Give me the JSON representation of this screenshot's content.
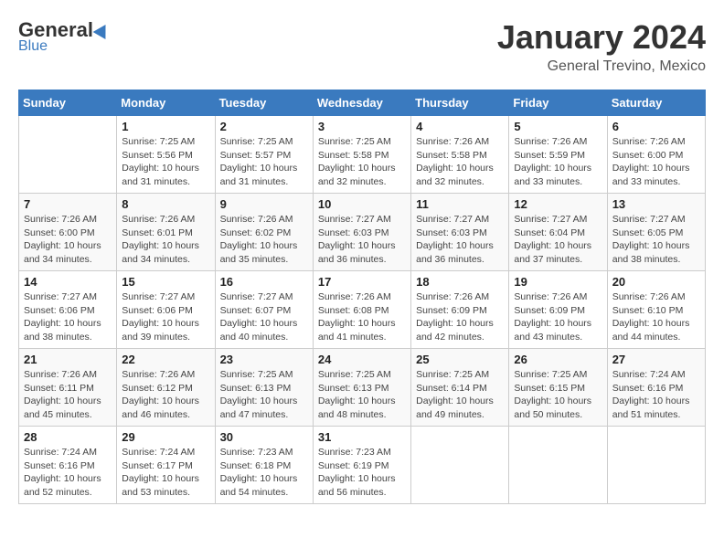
{
  "header": {
    "logo_general": "General",
    "logo_blue": "Blue",
    "month_title": "January 2024",
    "location": "General Trevino, Mexico"
  },
  "calendar": {
    "days_of_week": [
      "Sunday",
      "Monday",
      "Tuesday",
      "Wednesday",
      "Thursday",
      "Friday",
      "Saturday"
    ],
    "weeks": [
      [
        {
          "day": "",
          "info": ""
        },
        {
          "day": "1",
          "info": "Sunrise: 7:25 AM\nSunset: 5:56 PM\nDaylight: 10 hours\nand 31 minutes."
        },
        {
          "day": "2",
          "info": "Sunrise: 7:25 AM\nSunset: 5:57 PM\nDaylight: 10 hours\nand 31 minutes."
        },
        {
          "day": "3",
          "info": "Sunrise: 7:25 AM\nSunset: 5:58 PM\nDaylight: 10 hours\nand 32 minutes."
        },
        {
          "day": "4",
          "info": "Sunrise: 7:26 AM\nSunset: 5:58 PM\nDaylight: 10 hours\nand 32 minutes."
        },
        {
          "day": "5",
          "info": "Sunrise: 7:26 AM\nSunset: 5:59 PM\nDaylight: 10 hours\nand 33 minutes."
        },
        {
          "day": "6",
          "info": "Sunrise: 7:26 AM\nSunset: 6:00 PM\nDaylight: 10 hours\nand 33 minutes."
        }
      ],
      [
        {
          "day": "7",
          "info": "Sunrise: 7:26 AM\nSunset: 6:00 PM\nDaylight: 10 hours\nand 34 minutes."
        },
        {
          "day": "8",
          "info": "Sunrise: 7:26 AM\nSunset: 6:01 PM\nDaylight: 10 hours\nand 34 minutes."
        },
        {
          "day": "9",
          "info": "Sunrise: 7:26 AM\nSunset: 6:02 PM\nDaylight: 10 hours\nand 35 minutes."
        },
        {
          "day": "10",
          "info": "Sunrise: 7:27 AM\nSunset: 6:03 PM\nDaylight: 10 hours\nand 36 minutes."
        },
        {
          "day": "11",
          "info": "Sunrise: 7:27 AM\nSunset: 6:03 PM\nDaylight: 10 hours\nand 36 minutes."
        },
        {
          "day": "12",
          "info": "Sunrise: 7:27 AM\nSunset: 6:04 PM\nDaylight: 10 hours\nand 37 minutes."
        },
        {
          "day": "13",
          "info": "Sunrise: 7:27 AM\nSunset: 6:05 PM\nDaylight: 10 hours\nand 38 minutes."
        }
      ],
      [
        {
          "day": "14",
          "info": "Sunrise: 7:27 AM\nSunset: 6:06 PM\nDaylight: 10 hours\nand 38 minutes."
        },
        {
          "day": "15",
          "info": "Sunrise: 7:27 AM\nSunset: 6:06 PM\nDaylight: 10 hours\nand 39 minutes."
        },
        {
          "day": "16",
          "info": "Sunrise: 7:27 AM\nSunset: 6:07 PM\nDaylight: 10 hours\nand 40 minutes."
        },
        {
          "day": "17",
          "info": "Sunrise: 7:26 AM\nSunset: 6:08 PM\nDaylight: 10 hours\nand 41 minutes."
        },
        {
          "day": "18",
          "info": "Sunrise: 7:26 AM\nSunset: 6:09 PM\nDaylight: 10 hours\nand 42 minutes."
        },
        {
          "day": "19",
          "info": "Sunrise: 7:26 AM\nSunset: 6:09 PM\nDaylight: 10 hours\nand 43 minutes."
        },
        {
          "day": "20",
          "info": "Sunrise: 7:26 AM\nSunset: 6:10 PM\nDaylight: 10 hours\nand 44 minutes."
        }
      ],
      [
        {
          "day": "21",
          "info": "Sunrise: 7:26 AM\nSunset: 6:11 PM\nDaylight: 10 hours\nand 45 minutes."
        },
        {
          "day": "22",
          "info": "Sunrise: 7:26 AM\nSunset: 6:12 PM\nDaylight: 10 hours\nand 46 minutes."
        },
        {
          "day": "23",
          "info": "Sunrise: 7:25 AM\nSunset: 6:13 PM\nDaylight: 10 hours\nand 47 minutes."
        },
        {
          "day": "24",
          "info": "Sunrise: 7:25 AM\nSunset: 6:13 PM\nDaylight: 10 hours\nand 48 minutes."
        },
        {
          "day": "25",
          "info": "Sunrise: 7:25 AM\nSunset: 6:14 PM\nDaylight: 10 hours\nand 49 minutes."
        },
        {
          "day": "26",
          "info": "Sunrise: 7:25 AM\nSunset: 6:15 PM\nDaylight: 10 hours\nand 50 minutes."
        },
        {
          "day": "27",
          "info": "Sunrise: 7:24 AM\nSunset: 6:16 PM\nDaylight: 10 hours\nand 51 minutes."
        }
      ],
      [
        {
          "day": "28",
          "info": "Sunrise: 7:24 AM\nSunset: 6:16 PM\nDaylight: 10 hours\nand 52 minutes."
        },
        {
          "day": "29",
          "info": "Sunrise: 7:24 AM\nSunset: 6:17 PM\nDaylight: 10 hours\nand 53 minutes."
        },
        {
          "day": "30",
          "info": "Sunrise: 7:23 AM\nSunset: 6:18 PM\nDaylight: 10 hours\nand 54 minutes."
        },
        {
          "day": "31",
          "info": "Sunrise: 7:23 AM\nSunset: 6:19 PM\nDaylight: 10 hours\nand 56 minutes."
        },
        {
          "day": "",
          "info": ""
        },
        {
          "day": "",
          "info": ""
        },
        {
          "day": "",
          "info": ""
        }
      ]
    ]
  }
}
